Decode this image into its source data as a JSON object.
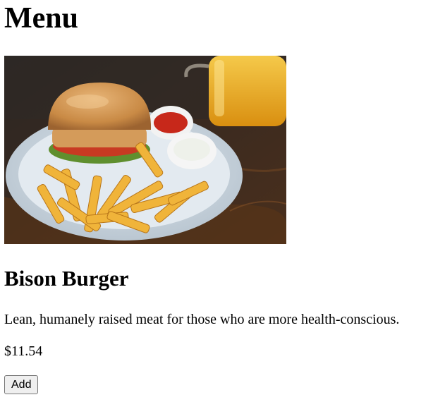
{
  "page": {
    "title": "Menu"
  },
  "item": {
    "image_icon": "burger-and-fries-photo",
    "name": "Bison Burger",
    "description": "Lean, humanely raised meat for those who are more health-conscious.",
    "price": "$11.54",
    "add_label": "Add"
  }
}
